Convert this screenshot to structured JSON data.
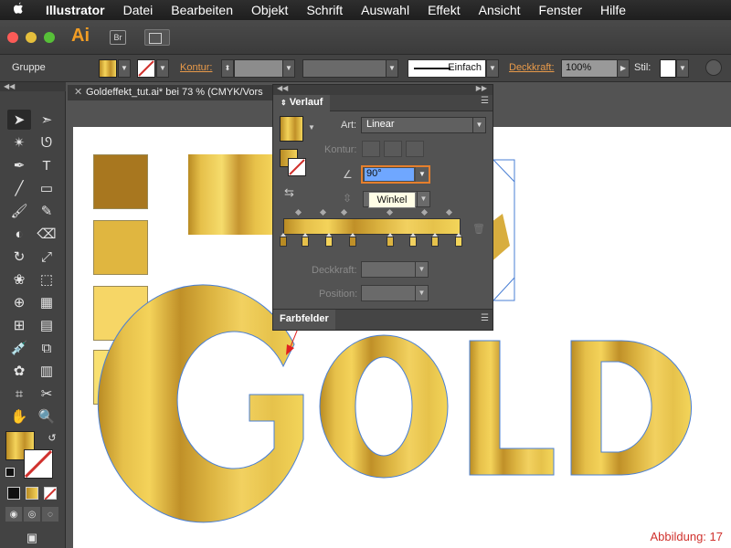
{
  "menubar": {
    "app_name": "Illustrator",
    "items": [
      "Datei",
      "Bearbeiten",
      "Objekt",
      "Schrift",
      "Auswahl",
      "Effekt",
      "Ansicht",
      "Fenster",
      "Hilfe"
    ]
  },
  "appbar": {
    "logo": "Ai",
    "bridge_label": "Br"
  },
  "controlbar": {
    "selection_label": "Gruppe",
    "kontur_label": "Kontur:",
    "stroke_style": "Einfach",
    "opacity_label": "Deckkraft:",
    "opacity_value": "100%",
    "style_label": "Stil:"
  },
  "document": {
    "tab_title": "Goldeffekt_tut.ai* bei 73 % (CMYK/Vors",
    "reference_label": "Abbildung: 17",
    "swatch_colors": [
      "#a8771f",
      "#e0b640",
      "#f6d666",
      "#f9e070"
    ],
    "artwork_text": "GOLD"
  },
  "gradient_panel": {
    "title": "Verlauf",
    "type_label": "Art:",
    "type_value": "Linear",
    "stroke_label": "Kontur:",
    "angle_value": "90°",
    "tooltip": "Winkel",
    "opacity_label": "Deckkraft:",
    "position_label": "Position:",
    "stop_colors": [
      "#b98b23",
      "#e6c04a",
      "#f4d35a",
      "#c09028",
      "#dcb441",
      "#f2d160",
      "#e6c24b",
      "#f3d55a"
    ]
  },
  "swatches_panel": {
    "title": "Farbfelder"
  }
}
